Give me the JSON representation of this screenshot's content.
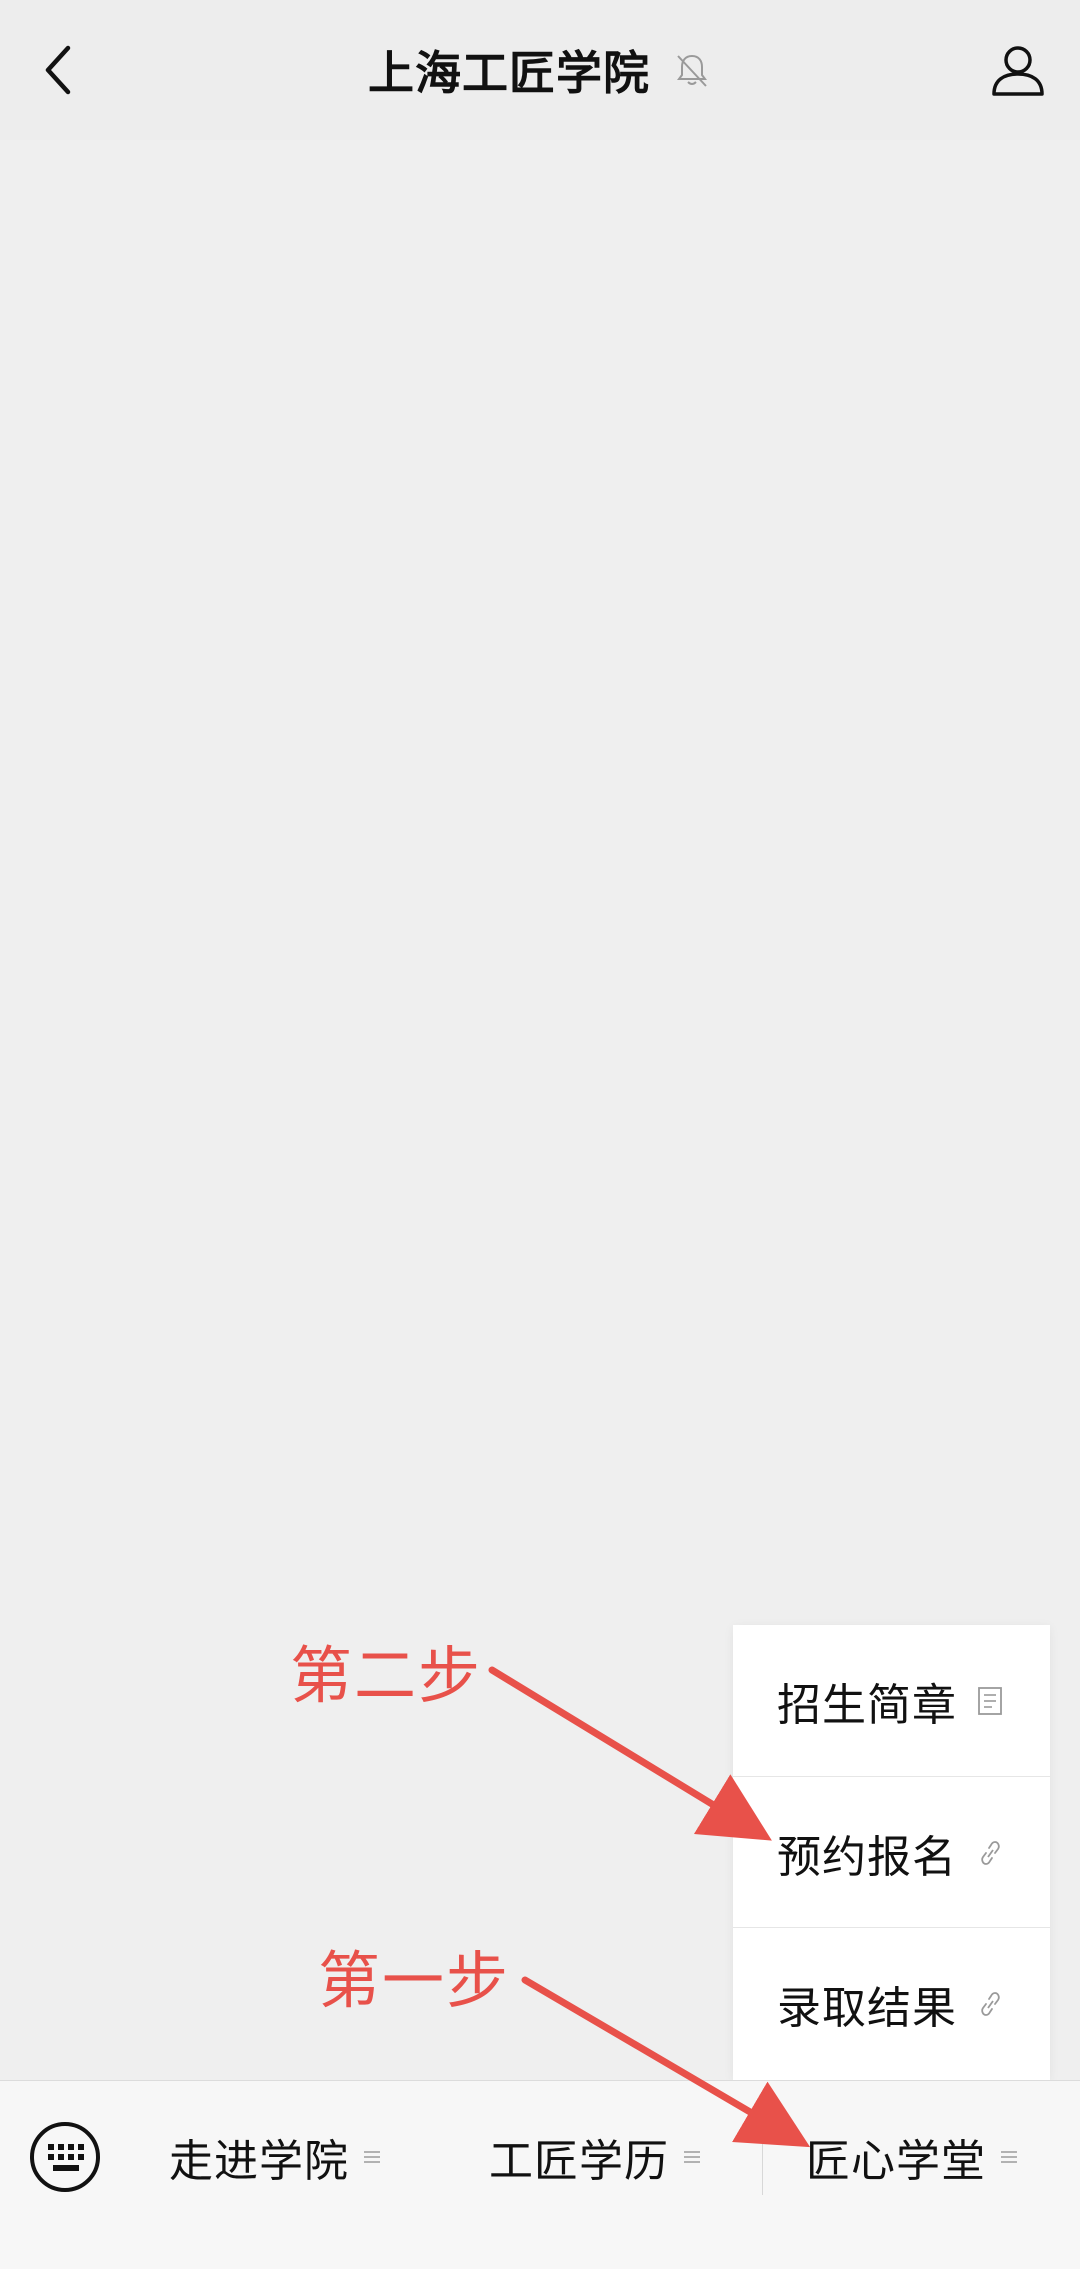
{
  "nav": {
    "title": "上海工匠学院",
    "back_icon": "chevron-left-icon",
    "mute_icon": "bell-off-icon",
    "profile_icon": "person-icon"
  },
  "submenu": {
    "items": [
      {
        "label": "招生简章",
        "icon": "document-icon"
      },
      {
        "label": "预约报名",
        "icon": "link-icon"
      },
      {
        "label": "录取结果",
        "icon": "link-icon"
      }
    ]
  },
  "bottom_menu": {
    "keyboard_icon": "keyboard-icon",
    "tabs": [
      {
        "label": "走进学院"
      },
      {
        "label": "工匠学历"
      },
      {
        "label": "匠心学堂"
      }
    ]
  },
  "annotations": {
    "step_one": "第一步",
    "step_two": "第二步",
    "color": "#e8514a"
  }
}
